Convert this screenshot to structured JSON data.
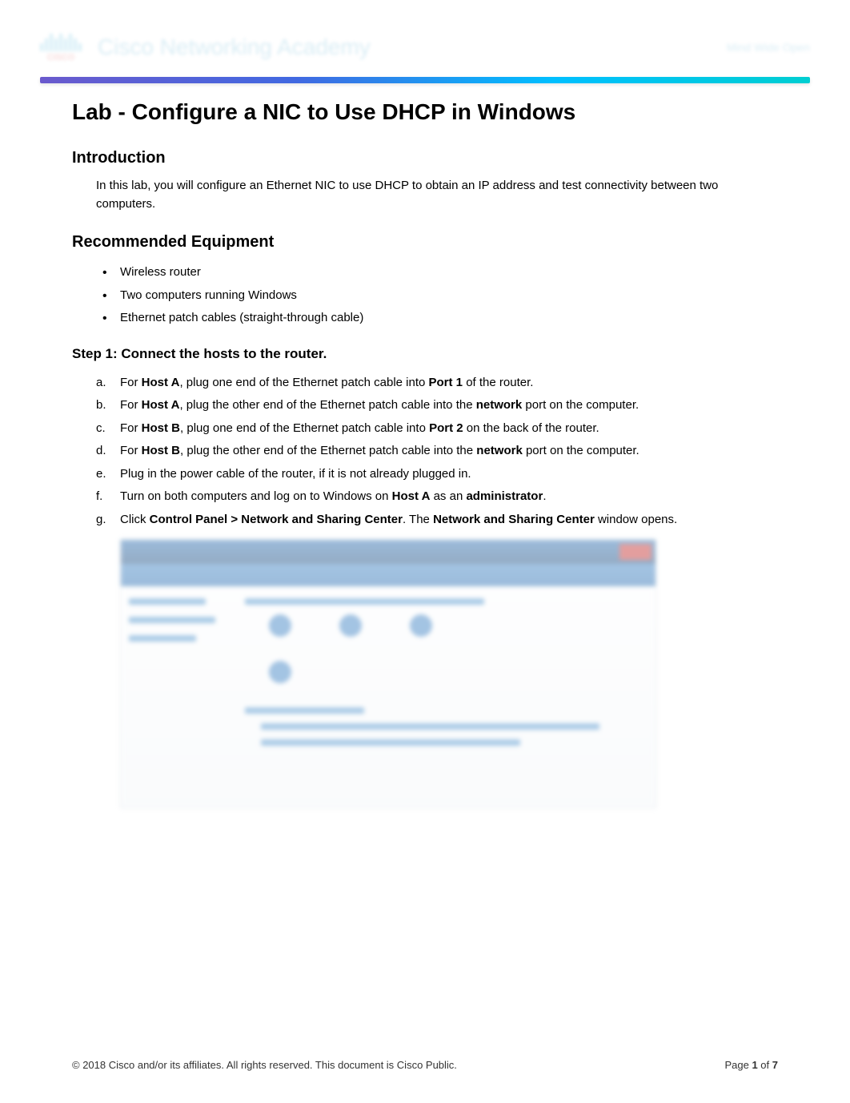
{
  "header": {
    "logo_text": "CISCO",
    "brand_title": "Cisco Networking Academy",
    "tagline": "Mind Wide Open"
  },
  "document": {
    "title": "Lab - Configure a NIC to Use DHCP in Windows",
    "sections": {
      "introduction": {
        "heading": "Introduction",
        "text": "In this lab, you will configure an Ethernet NIC to use DHCP to obtain an IP address and test connectivity between two computers."
      },
      "equipment": {
        "heading": "Recommended Equipment",
        "items": [
          "Wireless router",
          "Two computers running Windows",
          "Ethernet patch cables (straight-through cable)"
        ]
      },
      "step1": {
        "heading": "Step 1:   Connect the hosts to the router.",
        "items": [
          {
            "marker": "a.",
            "pre": "For ",
            "b1": "Host A",
            "mid1": ", plug one end of the Ethernet patch cable into ",
            "b2": "Port 1",
            "post": " of the router."
          },
          {
            "marker": "b.",
            "pre": "For ",
            "b1": "Host A",
            "mid1": ", plug the other end of the Ethernet patch cable into the ",
            "b2": "network",
            "post": " port on the computer."
          },
          {
            "marker": "c.",
            "pre": "For ",
            "b1": "Host B",
            "mid1": ", plug one end of the Ethernet patch cable into ",
            "b2": "Port 2",
            "post": " on the back of the router."
          },
          {
            "marker": "d.",
            "pre": "For ",
            "b1": "Host B",
            "mid1": ", plug the other end of the Ethernet patch cable into the ",
            "b2": "network",
            "post": " port on the computer."
          },
          {
            "marker": "e.",
            "pre": "Plug in the power cable of the router, if it is not already plugged in.",
            "b1": "",
            "mid1": "",
            "b2": "",
            "post": ""
          },
          {
            "marker": "f.",
            "pre": "Turn on both computers and log on to Windows on ",
            "b1": "Host A",
            "mid1": " as an ",
            "b2": "administrator",
            "post": "."
          },
          {
            "marker": "g.",
            "pre": "Click ",
            "b1": "Control Panel > Network and Sharing Center",
            "mid1": ". The ",
            "b2": "Network and Sharing Center",
            "post": " window opens."
          }
        ]
      }
    }
  },
  "footer": {
    "copyright": "© 2018 Cisco and/or its affiliates. All rights reserved. This document is Cisco Public.",
    "page_label": "Page ",
    "page_current": "1",
    "page_of": " of ",
    "page_total": "7"
  }
}
